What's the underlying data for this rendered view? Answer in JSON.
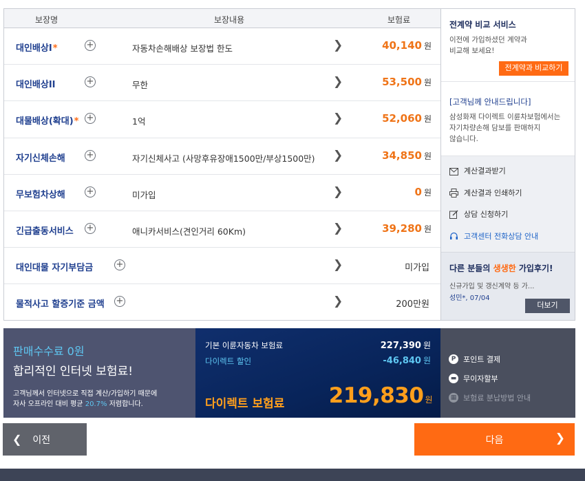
{
  "table": {
    "headers": {
      "name": "보장명",
      "content": "보장내용",
      "fee": "보험료"
    },
    "rows": [
      {
        "name": "대인배상I",
        "star": "*",
        "content": "자동차손해배상 보장법 한도",
        "fee": "40,140",
        "unit": "원"
      },
      {
        "name": "대인배상II",
        "star": "",
        "content": "무한",
        "fee": "53,500",
        "unit": "원"
      },
      {
        "name": "대물배상(확대)",
        "star": "*",
        "content": "1억",
        "fee": "52,060",
        "unit": "원"
      },
      {
        "name": "자기신체손해",
        "star": "",
        "content": "자기신체사고 (사망후유장애1500만/부상1500만)",
        "fee": "34,850",
        "unit": "원"
      },
      {
        "name": "무보험차상해",
        "star": "",
        "content": "미가입",
        "fee": "0",
        "unit": "원"
      },
      {
        "name": "긴급출동서비스",
        "star": "",
        "content": "애니카서비스(견인거리 60Km)",
        "fee": "39,280",
        "unit": "원"
      },
      {
        "name": "대인대물 자기부담금",
        "star": "",
        "content": "",
        "fee": "미가입",
        "unit": ""
      },
      {
        "name": "물적사고 할증기준 금액",
        "star": "",
        "content": "",
        "fee": "200만원",
        "unit": ""
      }
    ]
  },
  "side": {
    "compare": {
      "title": "전계약 비교 서비스",
      "text1": "이전에 가입하셨던 계약과",
      "text2": "비교해 보세요!",
      "button": "전계약과 비교하기"
    },
    "notice": {
      "title": "[고객님께 안내드립니다]",
      "text1": "삼성화재 다이렉트 이륜차보험에서는",
      "text2": "자기차량손해 담보를 판매하지",
      "text3": "않습니다."
    },
    "actions": {
      "receive": "계산결과받기",
      "print": "계산결과 인쇄하기",
      "consult": "상담 신청하기",
      "phone": "고객센터 전화상담 안내"
    },
    "review": {
      "title_pre": "다른 분들의 ",
      "title_hl": "생생한",
      "title_post": " 가입후기!",
      "text": "신규가입 및 갱신계약 등 가...",
      "meta": "성민*, 07/04",
      "button": "더보기"
    }
  },
  "promo": {
    "line1": "판매수수료 0원",
    "line2": "합리적인 인터넷 보험료!",
    "line3a": "고객님께서 인터넷으로 직접 계산/가입하기 때문에",
    "line3b_pre": "자사 오프라인 대비 평균 ",
    "line3b_hl": "20.7%",
    "line3b_post": " 저렴합니다."
  },
  "price": {
    "base_label": "기본 이륜자동차 보험료",
    "base_value": "227,390",
    "discount_label": "다이렉트 할인",
    "discount_value": "-46,840",
    "unit": "원",
    "total_label": "다이렉트 보험료",
    "total_value": "219,830"
  },
  "pay": {
    "point": "포인트 결제",
    "installment": "무이자할부",
    "guide": "보험료 분납방법 안내"
  },
  "nav": {
    "prev": "이전",
    "next": "다음"
  }
}
